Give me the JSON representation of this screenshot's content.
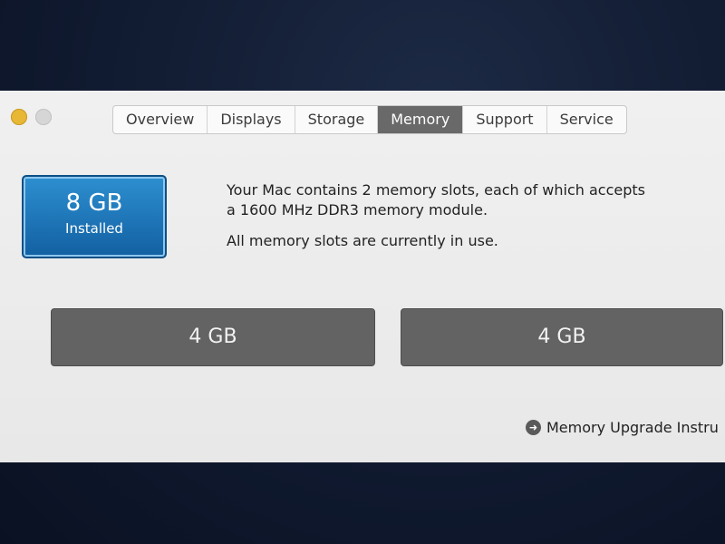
{
  "tabs": [
    {
      "label": "Overview"
    },
    {
      "label": "Displays"
    },
    {
      "label": "Storage"
    },
    {
      "label": "Memory"
    },
    {
      "label": "Support"
    },
    {
      "label": "Service"
    }
  ],
  "active_tab": "Memory",
  "installed": {
    "size": "8 GB",
    "label": "Installed"
  },
  "info": {
    "line1": "Your Mac contains 2 memory slots, each of which accepts",
    "line2": "a 1600 MHz DDR3 memory module.",
    "line3": "All memory slots are currently in use."
  },
  "slots": [
    {
      "label": "4 GB"
    },
    {
      "label": "4 GB"
    }
  ],
  "upgrade_link": "Memory Upgrade Instru",
  "colors": {
    "accent_blue": "#1f7dc1",
    "slot_gray": "#636363",
    "active_tab": "#696969"
  }
}
